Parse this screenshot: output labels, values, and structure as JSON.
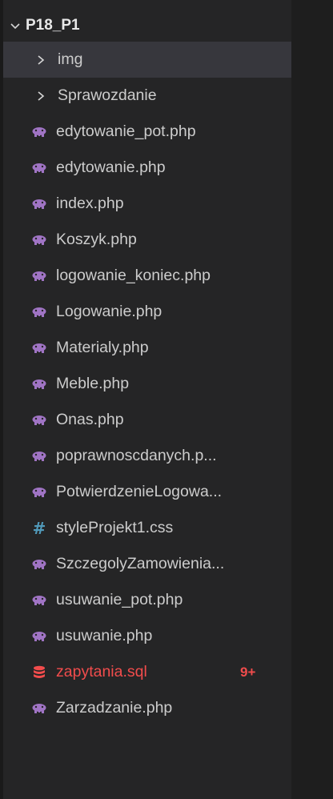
{
  "explorer": {
    "root_folder": "P18_P1",
    "items": [
      {
        "type": "folder",
        "label": "img",
        "selected": true,
        "icon": "chevron-right-icon"
      },
      {
        "type": "folder",
        "label": "Sprawozdanie",
        "icon": "chevron-right-icon"
      },
      {
        "type": "file",
        "label": "edytowanie_pot.php",
        "icon": "php-elephant-icon"
      },
      {
        "type": "file",
        "label": "edytowanie.php",
        "icon": "php-elephant-icon"
      },
      {
        "type": "file",
        "label": "index.php",
        "icon": "php-elephant-icon"
      },
      {
        "type": "file",
        "label": "Koszyk.php",
        "icon": "php-elephant-icon"
      },
      {
        "type": "file",
        "label": "logowanie_koniec.php",
        "icon": "php-elephant-icon"
      },
      {
        "type": "file",
        "label": "Logowanie.php",
        "icon": "php-elephant-icon"
      },
      {
        "type": "file",
        "label": "Materialy.php",
        "icon": "php-elephant-icon"
      },
      {
        "type": "file",
        "label": "Meble.php",
        "icon": "php-elephant-icon"
      },
      {
        "type": "file",
        "label": "Onas.php",
        "icon": "php-elephant-icon"
      },
      {
        "type": "file",
        "label": "poprawnoscdanych.p...",
        "icon": "php-elephant-icon"
      },
      {
        "type": "file",
        "label": "PotwierdzenieLogowa...",
        "icon": "php-elephant-icon"
      },
      {
        "type": "file",
        "label": "styleProjekt1.css",
        "icon": "css-hash-icon"
      },
      {
        "type": "file",
        "label": "SzczegolyZamowienia...",
        "icon": "php-elephant-icon"
      },
      {
        "type": "file",
        "label": "usuwanie_pot.php",
        "icon": "php-elephant-icon"
      },
      {
        "type": "file",
        "label": "usuwanie.php",
        "icon": "php-elephant-icon"
      },
      {
        "type": "file",
        "label": "zapytania.sql",
        "icon": "database-icon",
        "error": true,
        "badge": "9+"
      },
      {
        "type": "file",
        "label": "Zarzadzanie.php",
        "icon": "php-elephant-icon"
      }
    ]
  },
  "colors": {
    "php_icon": "#a074c4",
    "css_icon": "#519aba",
    "sql_icon": "#f14c4c",
    "error_text": "#f14c4c",
    "selected_row": "#37373d"
  }
}
